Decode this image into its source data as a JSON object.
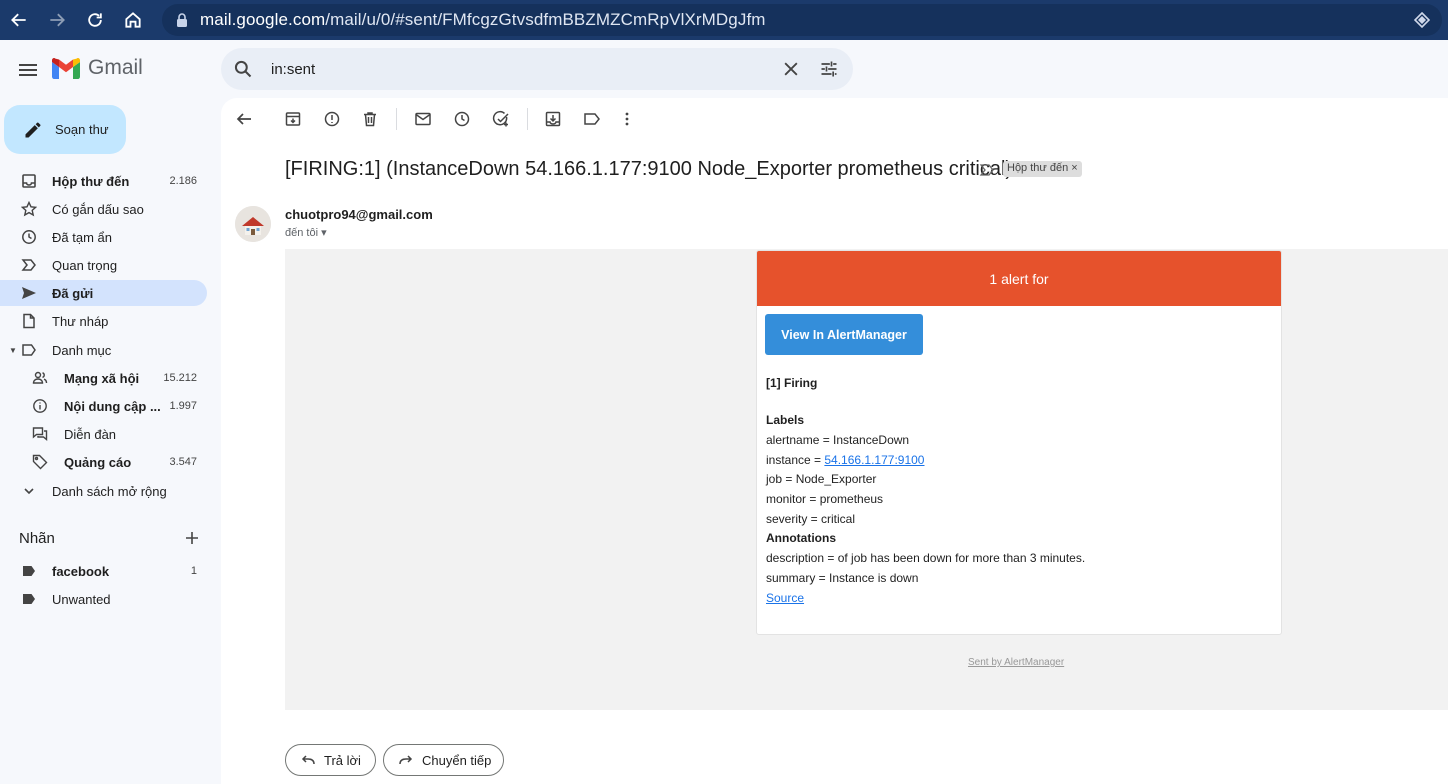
{
  "browser": {
    "url_host": "mail.google.com",
    "url_path": "/mail/u/0/#sent/FMfcgzGtvsdfmBBZMZCmRpVlXrMDgJfm"
  },
  "header": {
    "app_name": "Gmail",
    "search_query": "in:sent"
  },
  "sidebar": {
    "compose_label": "Soạn thư",
    "items": [
      {
        "label": "Hộp thư đến",
        "count": "2.186",
        "icon": "inbox-icon"
      },
      {
        "label": "Có gắn dấu sao",
        "count": "",
        "icon": "star-icon"
      },
      {
        "label": "Đã tạm ẩn",
        "count": "",
        "icon": "clock-icon"
      },
      {
        "label": "Quan trọng",
        "count": "",
        "icon": "important-icon"
      },
      {
        "label": "Đã gửi",
        "count": "",
        "icon": "send-icon"
      },
      {
        "label": "Thư nháp",
        "count": "",
        "icon": "draft-icon"
      },
      {
        "label": "Danh mục",
        "count": "",
        "icon": "label-icon"
      },
      {
        "label": "Mạng xã hội",
        "count": "15.212",
        "icon": "people-icon"
      },
      {
        "label": "Nội dung cập ...",
        "count": "1.997",
        "icon": "info-icon"
      },
      {
        "label": "Diễn đàn",
        "count": "",
        "icon": "forum-icon"
      },
      {
        "label": "Quảng cáo",
        "count": "3.547",
        "icon": "tag-icon"
      },
      {
        "label": "Danh sách mở rộng",
        "count": "",
        "icon": "chevron-down-icon"
      }
    ],
    "labels_title": "Nhãn",
    "labels": [
      {
        "label": "facebook",
        "count": "1"
      },
      {
        "label": "Unwanted",
        "count": ""
      }
    ]
  },
  "email": {
    "subject": "[FIRING:1] (InstanceDown 54.166.1.177:9100 Node_Exporter prometheus critical)",
    "inbox_chip": "Hộp thư đến",
    "sender": "chuotpro94@gmail.com",
    "to_me": "đến tôi",
    "alert_header": "1 alert for",
    "button_label": "View In AlertManager",
    "firing": "[1] Firing",
    "labels_heading": "Labels",
    "alertname": "alertname = InstanceDown",
    "instance_prefix": "instance = ",
    "instance_link": "54.166.1.177:9100",
    "job": "job = Node_Exporter",
    "monitor": "monitor = prometheus",
    "severity": "severity = critical",
    "annotations_heading": "Annotations",
    "description": "description = of job has been down for more than 3 minutes.",
    "summary": "summary = Instance is down",
    "source_link": "Source",
    "sent_by": "Sent by AlertManager"
  },
  "actions": {
    "reply": "Trả lời",
    "forward": "Chuyển tiếp"
  },
  "colors": {
    "alert_header": "#e6522c",
    "alert_button": "#348eda",
    "active_nav": "#d3e3fd",
    "compose_bg": "#c2e7ff"
  }
}
